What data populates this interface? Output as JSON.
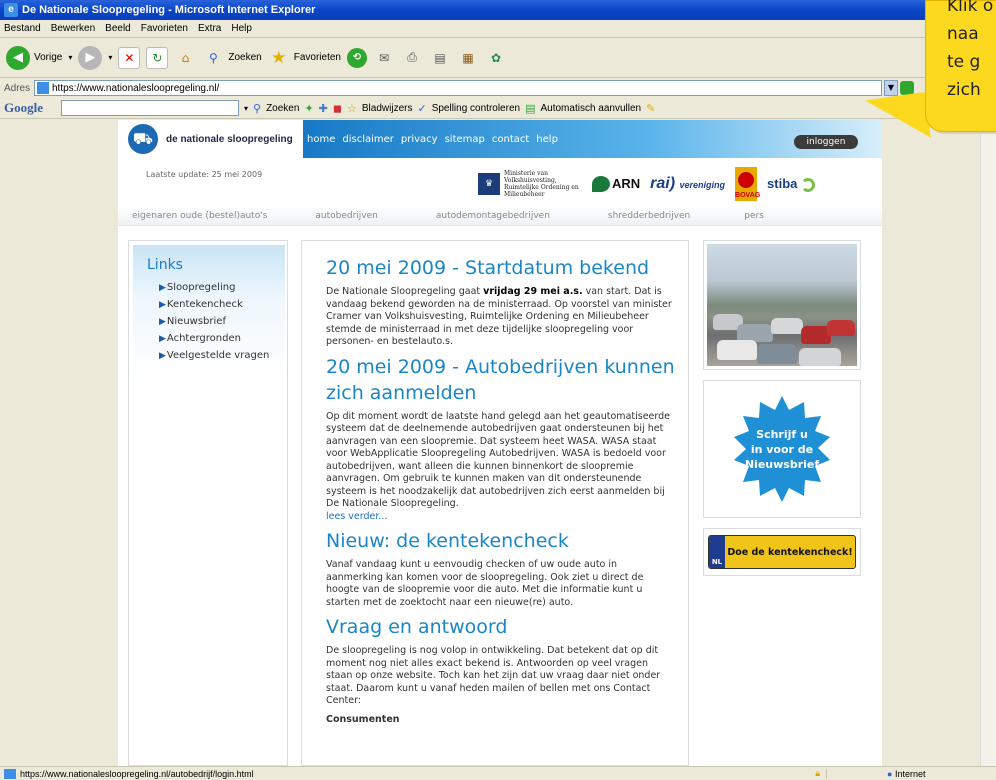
{
  "window": {
    "title": "De Nationale Sloopregeling - Microsoft Internet Explorer"
  },
  "menu": [
    "Bestand",
    "Bewerken",
    "Beeld",
    "Favorieten",
    "Extra",
    "Help"
  ],
  "toolbar": {
    "back": "Vorige",
    "search": "Zoeken",
    "favorites": "Favorieten"
  },
  "address": {
    "label": "Adres",
    "url": "https://www.nationalesloopregeling.nl/"
  },
  "google_toolbar": {
    "logo": "Google",
    "search": "Zoeken",
    "bookmarks": "Bladwijzers",
    "spelling": "Spelling controleren",
    "autofill": "Automatisch aanvullen"
  },
  "site": {
    "logo_text": "de nationale sloopregeling",
    "nav": [
      "home",
      "disclaimer",
      "privacy",
      "sitemap",
      "contact",
      "help"
    ],
    "login": "inloggen",
    "updated": "Laatste update: 25 mei 2009",
    "sponsors": {
      "ministry": "Ministerie van Volkshuisvesting, Ruimtelijke Ordening en Milieubeheer",
      "arn": "ARN",
      "rai": "rai",
      "rai_sub": "vereniging",
      "bovag": "BOVAG",
      "stiba": "stiba"
    },
    "categories": [
      "eigenaren oude (bestel)auto's",
      "autobedrijven",
      "autodemontagebedrijven",
      "shredderbedrijven",
      "pers"
    ]
  },
  "sidebar": {
    "title": "Links",
    "items": [
      "Sloopregeling",
      "Kentekencheck",
      "Nieuwsbrief",
      "Achtergronden",
      "Veelgestelde vragen"
    ]
  },
  "articles": [
    {
      "title": "20 mei 2009 - Startdatum bekend",
      "body_pre": "De Nationale Sloopregeling gaat ",
      "body_bold": "vrijdag 29 mei a.s.",
      "body_post": " van start. Dat is vandaag bekend geworden na de ministerraad. Op voorstel van minister Cramer van Volkshuisvesting, Ruimtelijke Ordening en Milieubeheer stemde de ministerraad in met deze tijdelijke sloopregeling voor personen- en bestelauto.s."
    },
    {
      "title": "20 mei 2009 - Autobedrijven kunnen zich aanmelden",
      "body": "Op dit moment wordt de laatste hand gelegd aan het geautomatiseerde systeem dat de deelnemende autobedrijven gaat ondersteunen bij het aanvragen van een sloopremie. Dat systeem heet WASA. WASA staat voor WebApplicatie Sloopregeling Autobedrijven. WASA is bedoeld voor autobedrijven, want alleen die kunnen binnenkort de sloopremie aanvragen. Om gebruik te kunnen maken van dit ondersteunende systeem is het noodzakelijk dat autobedrijven zich eerst aanmelden bij De Nationale Sloopregeling.",
      "more": "lees verder..."
    },
    {
      "title": "Nieuw: de kentekencheck",
      "body": "Vanaf vandaag kunt u eenvoudig checken of uw oude auto in aanmerking kan komen voor de sloopregeling. Ook ziet u direct de hoogte van de sloopremie voor die auto. Met die informatie kunt u starten met de zoektocht naar een nieuwe(re) auto."
    },
    {
      "title": "Vraag en antwoord",
      "body": "De sloopregeling is nog volop in ontwikkeling. Dat betekent dat op dit moment nog niet alles exact bekend is. Antwoorden op veel vragen staan op onze website. Toch kan het zijn dat uw vraag daar niet onder staat. Daarom kunt u vanaf heden mailen of bellen met ons Contact Center:",
      "sub": "Consumenten"
    }
  ],
  "right": {
    "badge": [
      "Schrijf u",
      "in voor de",
      "Nieuwsbrief"
    ],
    "kenteken_nl": "NL",
    "kenteken": "Doe de kentekencheck!"
  },
  "callout": "Klik o\nnaa\nte g\nzich",
  "status": {
    "url": "https://www.nationalesloopregeling.nl/autobedrijf/login.html",
    "zone": "Internet"
  },
  "colors": {
    "title_bar": "#0a46c8",
    "site_blue": "#1a86c8",
    "callout": "#fcd81e",
    "kenteken": "#f0c419"
  }
}
